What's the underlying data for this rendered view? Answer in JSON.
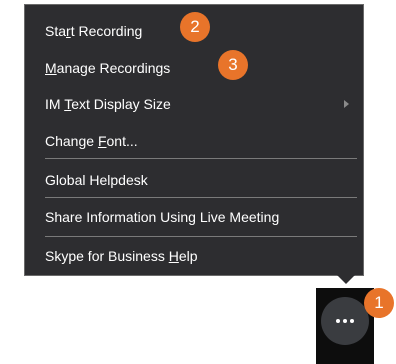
{
  "menu": {
    "items": [
      {
        "before": "Sta",
        "mnemonic": "r",
        "after": "t Recording"
      },
      {
        "before": "",
        "mnemonic": "M",
        "after": "anage Recordings"
      },
      {
        "before": "IM ",
        "mnemonic": "T",
        "after": "ext Display Size"
      },
      {
        "before": "Change ",
        "mnemonic": "F",
        "after": "ont..."
      },
      {
        "before": "Global Helpdesk",
        "mnemonic": "",
        "after": ""
      },
      {
        "before": "Share Information Using Live Meeting",
        "mnemonic": "",
        "after": ""
      },
      {
        "before": "Skype for Business ",
        "mnemonic": "H",
        "after": "elp"
      }
    ]
  },
  "badges": {
    "b1": "1",
    "b2": "2",
    "b3": "3"
  },
  "colors": {
    "menu_bg": "#2d2d30",
    "badge": "#e8742a",
    "more_bg": "#0d0d0d"
  },
  "icons": {
    "more": "more-options-icon",
    "submenu": "chevron-right-icon"
  }
}
